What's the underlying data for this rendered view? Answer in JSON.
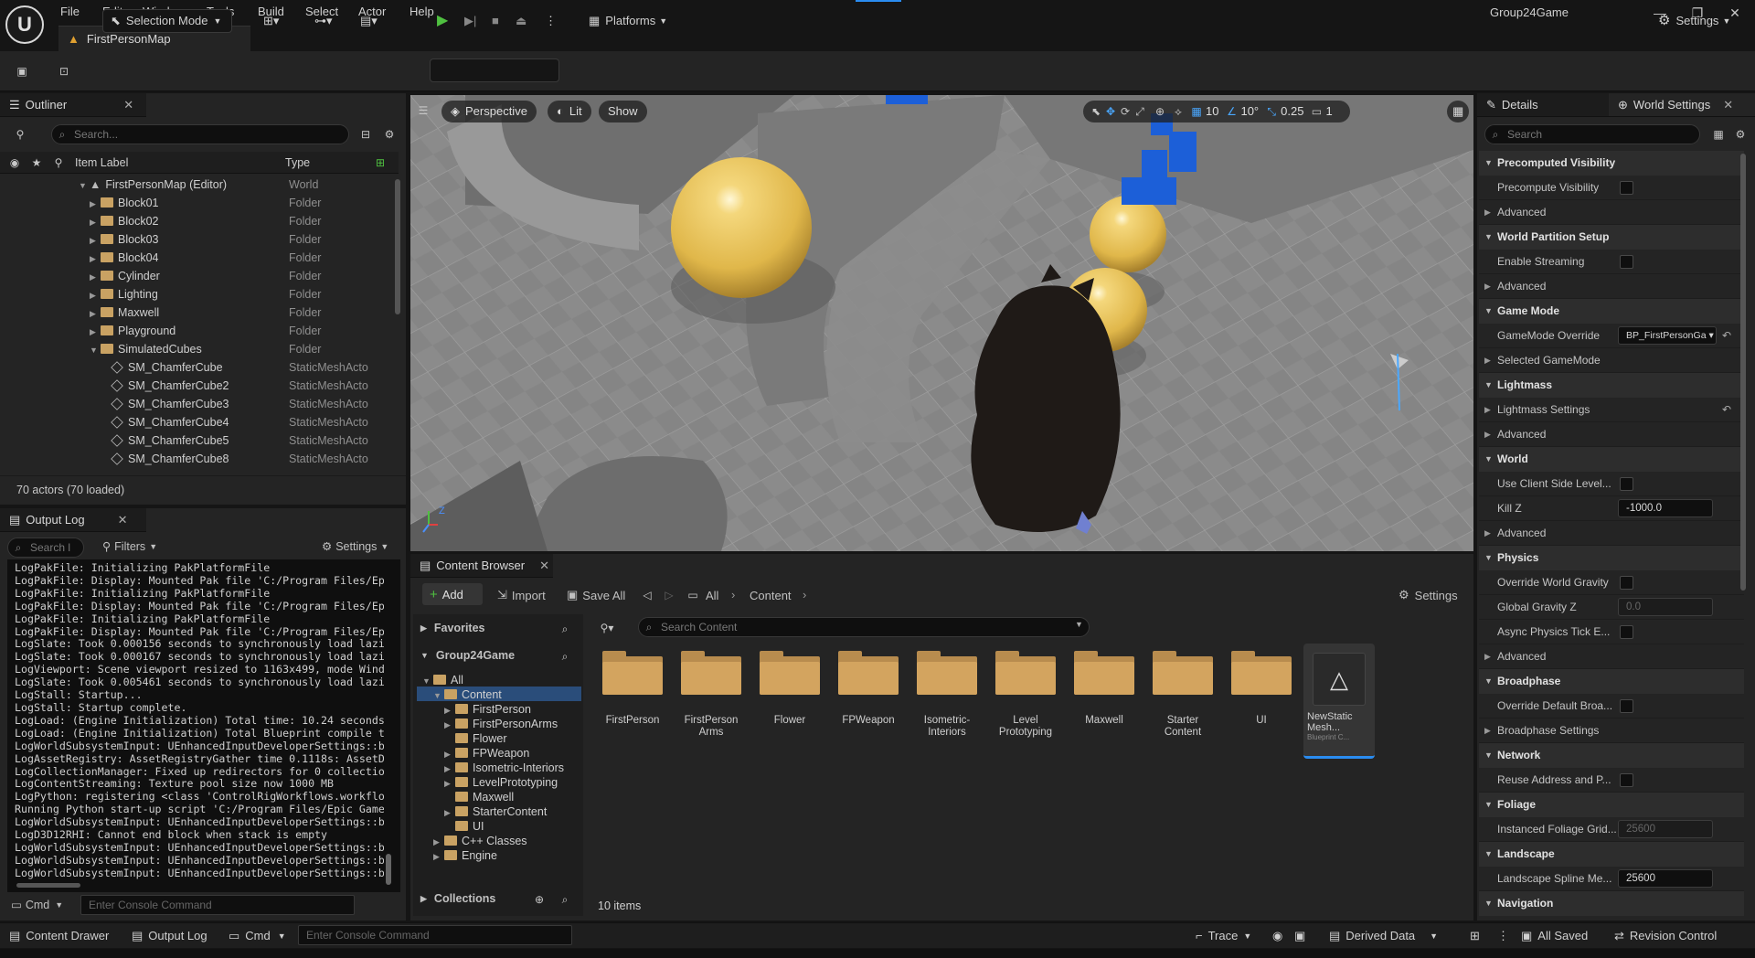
{
  "menu": {
    "items": [
      "File",
      "Edit",
      "Window",
      "Tools",
      "Build",
      "Select",
      "Actor",
      "Help"
    ]
  },
  "window": {
    "project": "Group24Game",
    "map_tab": "FirstPersonMap"
  },
  "toolbar": {
    "mode": "Selection Mode",
    "platforms": "Platforms",
    "settings": "Settings"
  },
  "outliner": {
    "title": "Outliner",
    "search_placeholder": "Search...",
    "col_label": "Item Label",
    "col_type": "Type",
    "rows": [
      {
        "label": "FirstPersonMap (Editor)",
        "type": "World"
      },
      {
        "label": "Block01",
        "type": "Folder"
      },
      {
        "label": "Block02",
        "type": "Folder"
      },
      {
        "label": "Block03",
        "type": "Folder"
      },
      {
        "label": "Block04",
        "type": "Folder"
      },
      {
        "label": "Cylinder",
        "type": "Folder"
      },
      {
        "label": "Lighting",
        "type": "Folder"
      },
      {
        "label": "Maxwell",
        "type": "Folder"
      },
      {
        "label": "Playground",
        "type": "Folder"
      },
      {
        "label": "SimulatedCubes",
        "type": "Folder"
      },
      {
        "label": "SM_ChamferCube",
        "type": "StaticMeshActo"
      },
      {
        "label": "SM_ChamferCube2",
        "type": "StaticMeshActo"
      },
      {
        "label": "SM_ChamferCube3",
        "type": "StaticMeshActo"
      },
      {
        "label": "SM_ChamferCube4",
        "type": "StaticMeshActo"
      },
      {
        "label": "SM_ChamferCube5",
        "type": "StaticMeshActo"
      },
      {
        "label": "SM_ChamferCube8",
        "type": "StaticMeshActo"
      }
    ],
    "actor_count": "70 actors (70 loaded)"
  },
  "output_log": {
    "title": "Output Log",
    "search_placeholder": "Search l",
    "filters": "Filters",
    "settings": "Settings",
    "lines": [
      "LogPakFile: Initializing PakPlatformFile",
      "LogPakFile: Display: Mounted Pak file 'C:/Program Files/Ep",
      "LogPakFile: Initializing PakPlatformFile",
      "LogPakFile: Display: Mounted Pak file 'C:/Program Files/Ep",
      "LogPakFile: Initializing PakPlatformFile",
      "LogPakFile: Display: Mounted Pak file 'C:/Program Files/Ep",
      "LogSlate: Took 0.000156 seconds to synchronously load lazi",
      "LogSlate: Took 0.000167 seconds to synchronously load lazi",
      "LogViewport: Scene viewport resized to 1163x499, mode Wind",
      "LogSlate: Took 0.005461 seconds to synchronously load lazi",
      "LogStall: Startup...",
      "LogStall: Startup complete.",
      "LogLoad: (Engine Initialization) Total time: 10.24 seconds",
      "LogLoad: (Engine Initialization) Total Blueprint compile t",
      "LogWorldSubsystemInput: UEnhancedInputDeveloperSettings::b",
      "LogAssetRegistry: AssetRegistryGather time 0.1118s: AssetD",
      "LogCollectionManager: Fixed up redirectors for 0 collectio",
      "LogContentStreaming: Texture pool size now 1000 MB",
      "LogPython: registering <class 'ControlRigWorkflows.workflo",
      "Running Python start-up script 'C:/Program Files/Epic Game",
      "LogWorldSubsystemInput: UEnhancedInputDeveloperSettings::b",
      "LogD3D12RHI: Cannot end block when stack is empty",
      "LogWorldSubsystemInput: UEnhancedInputDeveloperSettings::b",
      "LogWorldSubsystemInput: UEnhancedInputDeveloperSettings::b",
      "LogWorldSubsystemInput: UEnhancedInputDeveloperSettings::b"
    ],
    "cmd": "Cmd",
    "console_placeholder": "Enter Console Command"
  },
  "viewport": {
    "perspective": "Perspective",
    "lit": "Lit",
    "show": "Show",
    "grid": "10",
    "angle": "10°",
    "scale": "0.25",
    "camera": "1"
  },
  "content_browser": {
    "title": "Content Browser",
    "add": "Add",
    "import": "Import",
    "save_all": "Save All",
    "breadcrumb": [
      "All",
      "Content"
    ],
    "settings": "Settings",
    "favorites": "Favorites",
    "project": "Group24Game",
    "search_placeholder": "Search Content",
    "tree": [
      {
        "label": "All",
        "depth": 0
      },
      {
        "label": "Content",
        "depth": 1
      },
      {
        "label": "FirstPerson",
        "depth": 2
      },
      {
        "label": "FirstPersonArms",
        "depth": 2
      },
      {
        "label": "Flower",
        "depth": 2
      },
      {
        "label": "FPWeapon",
        "depth": 2
      },
      {
        "label": "Isometric-Interiors",
        "depth": 2
      },
      {
        "label": "LevelPrototyping",
        "depth": 2
      },
      {
        "label": "Maxwell",
        "depth": 2
      },
      {
        "label": "StarterContent",
        "depth": 2
      },
      {
        "label": "UI",
        "depth": 2
      },
      {
        "label": "C++ Classes",
        "depth": 1
      },
      {
        "label": "Engine",
        "depth": 1
      }
    ],
    "assets": [
      {
        "line1": "FirstPerson",
        "line2": ""
      },
      {
        "line1": "FirstPerson",
        "line2": "Arms"
      },
      {
        "line1": "Flower",
        "line2": ""
      },
      {
        "line1": "FPWeapon",
        "line2": ""
      },
      {
        "line1": "Isometric-",
        "line2": "Interiors"
      },
      {
        "line1": "Level",
        "line2": "Prototyping"
      },
      {
        "line1": "Maxwell",
        "line2": ""
      },
      {
        "line1": "Starter",
        "line2": "Content"
      },
      {
        "line1": "UI",
        "line2": ""
      }
    ],
    "bp_asset": {
      "line1": "NewStatic",
      "line2": "Mesh...",
      "sub": "Blueprint C..."
    },
    "collections": "Collections",
    "item_count": "10 items"
  },
  "details": {
    "tab_details": "Details",
    "tab_world": "World Settings",
    "search_placeholder": "Search",
    "rows": [
      {
        "kind": "section",
        "label": "Precomputed Visibility"
      },
      {
        "kind": "check",
        "label": "Precompute Visibility"
      },
      {
        "kind": "sub",
        "label": "Advanced"
      },
      {
        "kind": "section",
        "label": "World Partition Setup"
      },
      {
        "kind": "check",
        "label": "Enable Streaming"
      },
      {
        "kind": "sub",
        "label": "Advanced"
      },
      {
        "kind": "section",
        "label": "Game Mode"
      },
      {
        "kind": "combo",
        "label": "GameMode Override",
        "value": "BP_FirstPersonGa"
      },
      {
        "kind": "sub",
        "label": "Selected GameMode"
      },
      {
        "kind": "section",
        "label": "Lightmass"
      },
      {
        "kind": "sub",
        "label": "Lightmass Settings"
      },
      {
        "kind": "sub",
        "label": "Advanced"
      },
      {
        "kind": "section",
        "label": "World"
      },
      {
        "kind": "check",
        "label": "Use Client Side Level..."
      },
      {
        "kind": "num",
        "label": "Kill Z",
        "value": "-1000.0"
      },
      {
        "kind": "sub",
        "label": "Advanced"
      },
      {
        "kind": "section",
        "label": "Physics"
      },
      {
        "kind": "check",
        "label": "Override World Gravity"
      },
      {
        "kind": "numdim",
        "label": "Global Gravity Z",
        "value": "0.0"
      },
      {
        "kind": "check",
        "label": "Async Physics Tick E..."
      },
      {
        "kind": "sub",
        "label": "Advanced"
      },
      {
        "kind": "section",
        "label": "Broadphase"
      },
      {
        "kind": "check",
        "label": "Override Default Broa..."
      },
      {
        "kind": "sub",
        "label": "Broadphase Settings"
      },
      {
        "kind": "section",
        "label": "Network"
      },
      {
        "kind": "check",
        "label": "Reuse Address and P..."
      },
      {
        "kind": "section",
        "label": "Foliage"
      },
      {
        "kind": "numdim",
        "label": "Instanced Foliage Grid...",
        "value": "25600"
      },
      {
        "kind": "section",
        "label": "Landscape"
      },
      {
        "kind": "num",
        "label": "Landscape Spline Me...",
        "value": "25600"
      },
      {
        "kind": "section",
        "label": "Navigation"
      }
    ]
  },
  "statusbar": {
    "content_drawer": "Content Drawer",
    "output_log": "Output Log",
    "cmd": "Cmd",
    "console_placeholder": "Enter Console Command",
    "trace": "Trace",
    "derived_data": "Derived Data",
    "all_saved": "All Saved",
    "revision_control": "Revision Control"
  }
}
